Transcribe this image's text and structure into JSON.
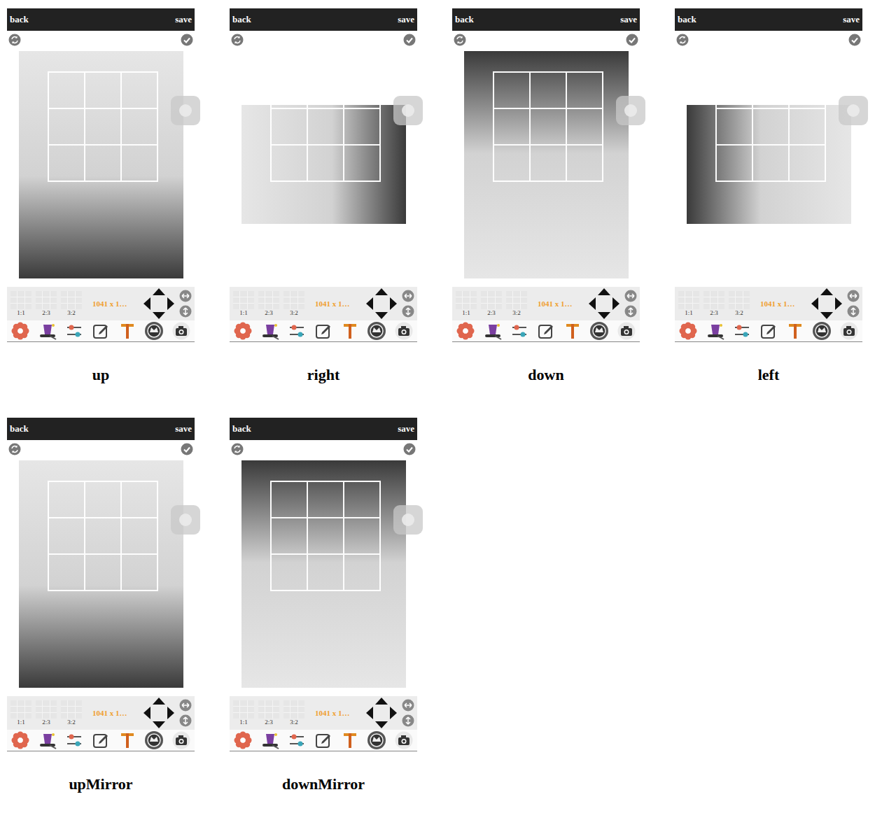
{
  "panels": [
    {
      "back": "back",
      "save": "save",
      "kind": "portrait",
      "flipped": false,
      "ratios": [
        "1:1",
        "2:3",
        "3:2"
      ],
      "size": "1041 x 1…",
      "caption": "up"
    },
    {
      "back": "back",
      "save": "save",
      "kind": "landscape",
      "flipped": false,
      "ratios": [
        "1:1",
        "2:3",
        "3:2"
      ],
      "size": "1041 x 1…",
      "caption": "right"
    },
    {
      "back": "back",
      "save": "save",
      "kind": "portrait",
      "flipped": true,
      "ratios": [
        "1:1",
        "2:3",
        "3:2"
      ],
      "size": "1041 x 1…",
      "caption": "down"
    },
    {
      "back": "back",
      "save": "save",
      "kind": "landscape",
      "flipped": true,
      "ratios": [
        "1:1",
        "2:3",
        "3:2"
      ],
      "size": "1041 x 1…",
      "caption": "left"
    },
    {
      "back": "back",
      "save": "save",
      "kind": "portrait",
      "flipped": false,
      "ratios": [
        "1:1",
        "2:3",
        "3:2"
      ],
      "size": "1041 x 1…",
      "caption": "upMirror"
    },
    {
      "back": "back",
      "save": "save",
      "kind": "portrait",
      "flipped": true,
      "ratios": [
        "1:1",
        "2:3",
        "3:2"
      ],
      "size": "1041 x 1…",
      "caption": "downMirror"
    }
  ]
}
